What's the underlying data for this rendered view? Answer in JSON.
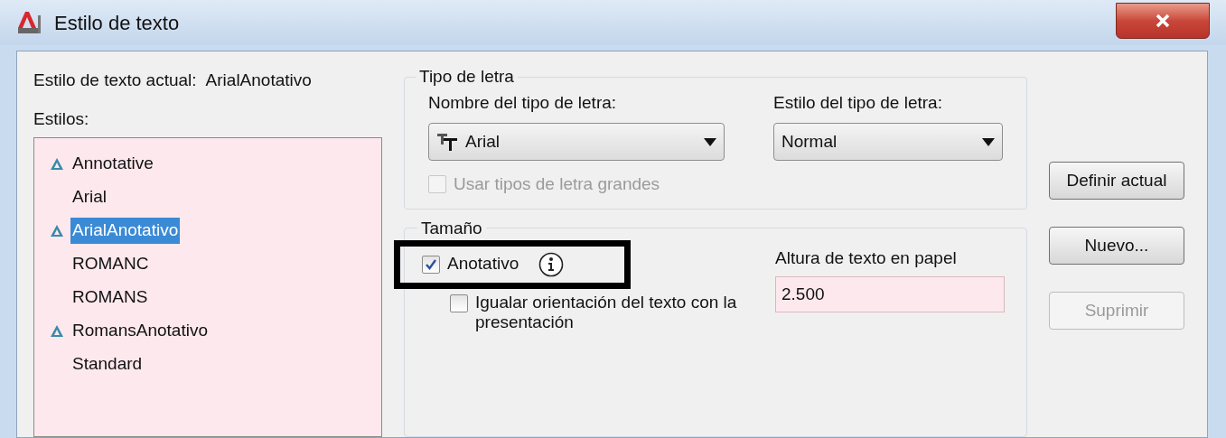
{
  "window": {
    "title": "Estilo de texto"
  },
  "current_style": {
    "label": "Estilo de texto actual:",
    "value": "ArialAnotativo"
  },
  "styles": {
    "label": "Estilos:",
    "items": [
      {
        "name": "Annotative",
        "annotative": true,
        "selected": false
      },
      {
        "name": "Arial",
        "annotative": false,
        "selected": false
      },
      {
        "name": "ArialAnotativo",
        "annotative": true,
        "selected": true
      },
      {
        "name": "ROMANC",
        "annotative": false,
        "selected": false
      },
      {
        "name": "ROMANS",
        "annotative": false,
        "selected": false
      },
      {
        "name": "RomansAnotativo",
        "annotative": true,
        "selected": false
      },
      {
        "name": "Standard",
        "annotative": false,
        "selected": false
      }
    ]
  },
  "font": {
    "title": "Tipo de letra",
    "name_label": "Nombre del tipo de letra:",
    "name_value": "Arial",
    "style_label": "Estilo del tipo de letra:",
    "style_value": "Normal",
    "big_font": {
      "label": "Usar tipos de letra grandes",
      "checked": false,
      "disabled": true
    }
  },
  "size": {
    "title": "Tamaño",
    "annotative": {
      "label": "Anotativo",
      "checked": true,
      "highlighted": true
    },
    "match_orientation": {
      "label": "Igualar orientación del texto con la presentación",
      "checked": false
    },
    "height_label": "Altura de texto en papel",
    "height_value": "2.500"
  },
  "buttons": [
    {
      "label": "Definir actual",
      "disabled": false
    },
    {
      "label": "Nuevo...",
      "disabled": false
    },
    {
      "label": "Suprimir",
      "disabled": true
    }
  ]
}
